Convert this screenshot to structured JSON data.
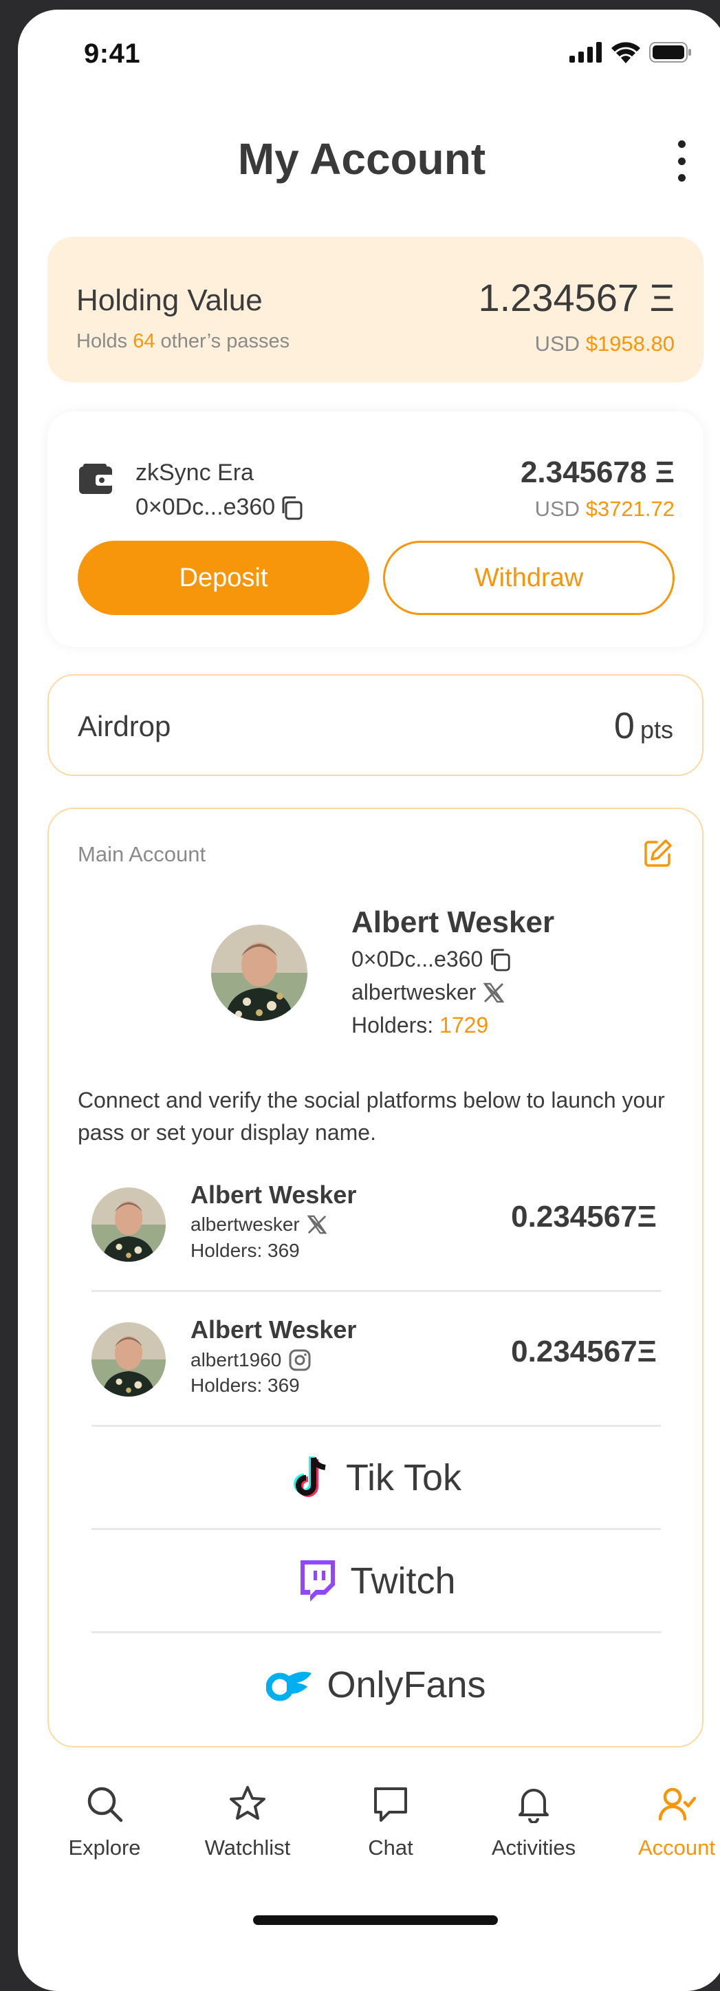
{
  "status_bar": {
    "time": "9:41"
  },
  "header": {
    "title": "My Account"
  },
  "holding": {
    "label": "Holding Value",
    "holds_prefix": "Holds",
    "holds_count": "64",
    "holds_suffix": "other’s passes",
    "value": "1.234567 Ξ",
    "usd_label": "USD",
    "usd_value": "$1958.80"
  },
  "wallet": {
    "network": "zkSync Era",
    "address": "0×0Dc...e360",
    "balance": "2.345678 Ξ",
    "usd_label": "USD",
    "usd_value": "$3721.72",
    "deposit_label": "Deposit",
    "withdraw_label": "Withdraw"
  },
  "airdrop": {
    "label": "Airdrop",
    "points": "0",
    "unit": "pts"
  },
  "main_account": {
    "title": "Main Account",
    "name": "Albert Wesker",
    "address": "0×0Dc...e360",
    "handle": "albertwesker",
    "holders_label": "Holders:",
    "holders_count": "1729",
    "description": "Connect and verify the social platforms below to launch your pass or set your display name.",
    "socials": [
      {
        "name": "Albert Wesker",
        "handle": "albertwesker",
        "platform_icon": "x-icon",
        "holders": "Holders: 369",
        "amount": "0.234567Ξ"
      },
      {
        "name": "Albert Wesker",
        "handle": "albert1960",
        "platform_icon": "instagram-icon",
        "holders": "Holders: 369",
        "amount": "0.234567Ξ"
      }
    ],
    "platforms": [
      {
        "label": "Tik Tok",
        "icon": "tiktok-icon"
      },
      {
        "label": "Twitch",
        "icon": "twitch-icon"
      },
      {
        "label": "OnlyFans",
        "icon": "onlyfans-icon"
      }
    ]
  },
  "nav": {
    "items": [
      {
        "label": "Explore",
        "icon": "search-icon"
      },
      {
        "label": "Watchlist",
        "icon": "star-icon"
      },
      {
        "label": "Chat",
        "icon": "chat-icon"
      },
      {
        "label": "Activities",
        "icon": "bell-icon"
      },
      {
        "label": "Account",
        "icon": "user-check-icon",
        "active": true
      }
    ]
  },
  "colors": {
    "accent": "#f7960a",
    "card_tint": "#fff0db",
    "border": "#ffd9a3",
    "text": "#3b3b3b"
  }
}
